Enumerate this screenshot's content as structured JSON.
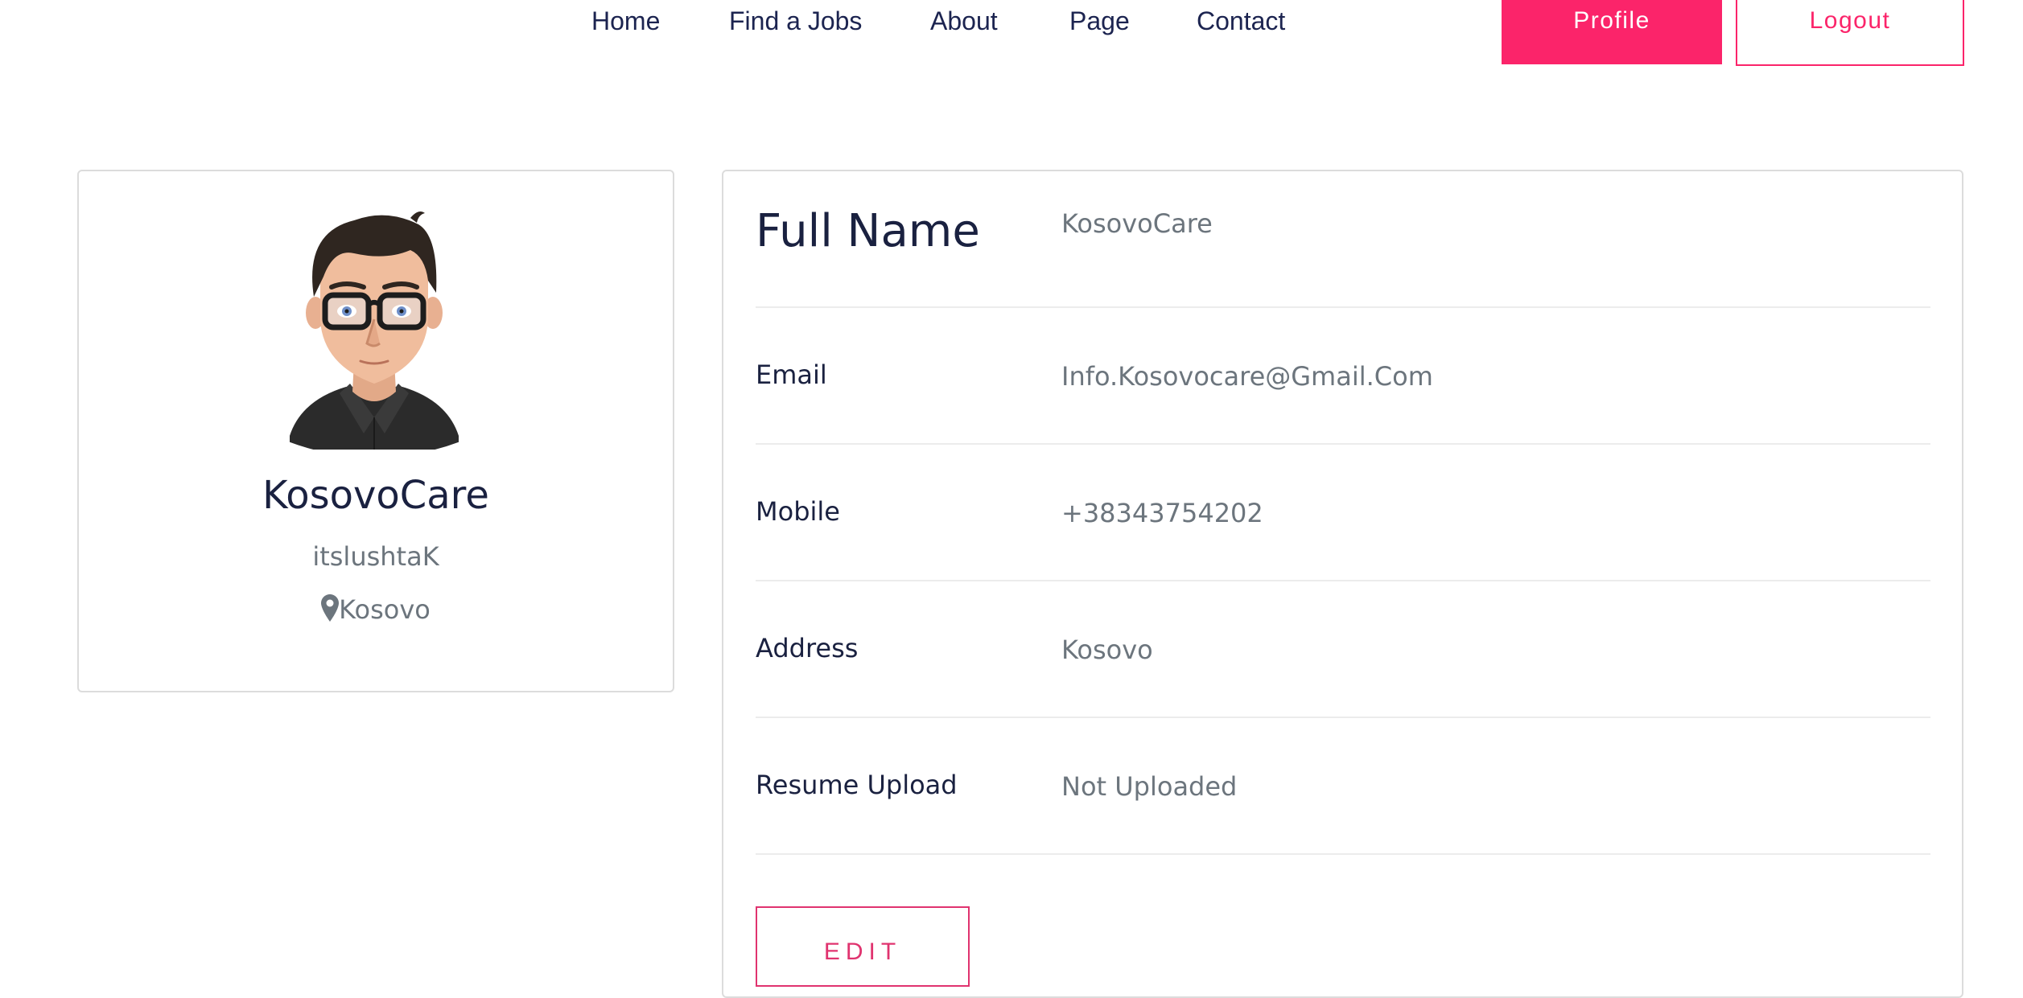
{
  "nav": {
    "links": [
      {
        "label": "Home"
      },
      {
        "label": "Find a Jobs"
      },
      {
        "label": "About"
      },
      {
        "label": "Page"
      },
      {
        "label": "Contact"
      }
    ],
    "profile_label": "Profile",
    "logout_label": "Logout"
  },
  "profile_card": {
    "name": "KosovoCare",
    "username": "itslushtaK",
    "location": "Kosovo",
    "location_icon": "map-pin-icon"
  },
  "details": {
    "full_name": {
      "label": "Full Name",
      "value": "KosovoCare"
    },
    "email": {
      "label": "Email",
      "value": "Info.Kosovocare@Gmail.Com"
    },
    "mobile": {
      "label": "Mobile",
      "value": "+38343754202"
    },
    "address": {
      "label": "Address",
      "value": "Kosovo"
    },
    "resume": {
      "label": "Resume Upload",
      "value": "Not Uploaded"
    },
    "edit_label": "EDIT"
  },
  "colors": {
    "accent": "#fb246a",
    "heading": "#1a2140",
    "muted": "#6c757d",
    "border": "#dcdcdc"
  }
}
